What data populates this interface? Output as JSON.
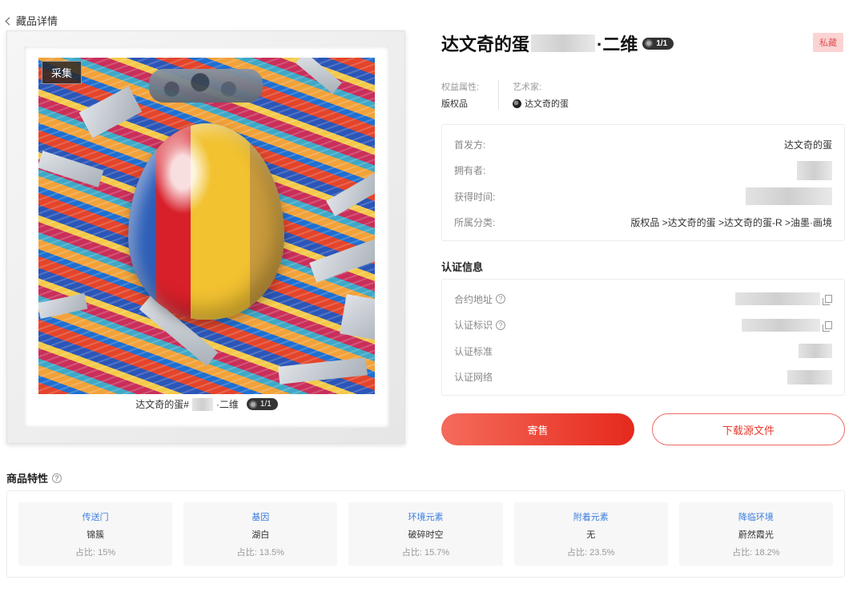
{
  "header": {
    "back_label": "藏品详情"
  },
  "artwork": {
    "badge": "采集",
    "caption_prefix": "达文奇的蛋#",
    "caption_suffix": "·二维",
    "edition": "1/1"
  },
  "detail": {
    "title_prefix": "达文奇的蛋",
    "title_suffix": "·二维",
    "edition": "1/1",
    "status_tag": "私藏",
    "rights_label": "权益属性:",
    "rights_value": "版权品",
    "artist_label": "艺术家:",
    "artist_value": "达文奇的蛋"
  },
  "info": {
    "rows": [
      {
        "label": "首发方:",
        "value": "达文奇的蛋"
      },
      {
        "label": "拥有者:",
        "value": ""
      },
      {
        "label": "获得时间:",
        "value": ""
      },
      {
        "label": "所属分类:",
        "value": "版权品 >达文奇的蛋 >达文奇的蛋-R >油墨·画境"
      }
    ]
  },
  "cert": {
    "title": "认证信息",
    "rows": [
      {
        "label": "合约地址"
      },
      {
        "label": "认证标识"
      },
      {
        "label": "认证标准"
      },
      {
        "label": "认证网络"
      }
    ]
  },
  "actions": {
    "primary": "寄售",
    "secondary": "下载源文件"
  },
  "features": {
    "title": "商品特性",
    "items": [
      {
        "name": "传送门",
        "value": "锦簇",
        "ratio": "占比: 15%"
      },
      {
        "name": "基因",
        "value": "湖白",
        "ratio": "占比: 13.5%"
      },
      {
        "name": "环境元素",
        "value": "破碎时空",
        "ratio": "占比: 15.7%"
      },
      {
        "name": "附着元素",
        "value": "无",
        "ratio": "占比: 23.5%"
      },
      {
        "name": "降临环境",
        "value": "蔚然霞光",
        "ratio": "占比: 18.2%"
      }
    ]
  },
  "colors": {
    "accent": "#e5291d",
    "link": "#3b7de0",
    "tag_bg": "#fbd3d3"
  }
}
